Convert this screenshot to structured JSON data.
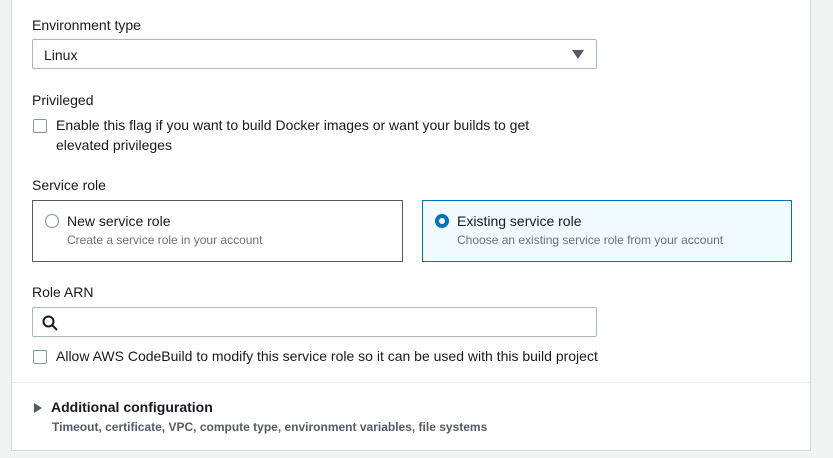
{
  "environment_type": {
    "label": "Environment type",
    "selected": "Linux"
  },
  "privileged": {
    "label": "Privileged",
    "checkbox_line1": "Enable this flag if you want to build Docker images or want your builds to get",
    "checkbox_line2": "elevated privileges",
    "checked": false
  },
  "service_role": {
    "label": "Service role",
    "options": [
      {
        "title": "New service role",
        "description": "Create a service role in your account",
        "selected": false
      },
      {
        "title": "Existing service role",
        "description": "Choose an existing service role from your account",
        "selected": true
      }
    ]
  },
  "role_arn": {
    "label": "Role ARN",
    "value": "",
    "placeholder": ""
  },
  "allow_modify": {
    "label": "Allow AWS CodeBuild to modify this service role so it can be used with this build project",
    "checked": false
  },
  "additional_configuration": {
    "title": "Additional configuration",
    "description": "Timeout, certificate, VPC, compute type, environment variables, file systems",
    "expanded": false
  },
  "colors": {
    "accent": "#0073bb",
    "selected_tile_bg": "#f1faff",
    "border": "#aab7b8",
    "muted_text": "#687078"
  },
  "icons": {
    "select_caret": "caret-down-icon",
    "search": "search-icon",
    "expander": "caret-right-icon"
  }
}
